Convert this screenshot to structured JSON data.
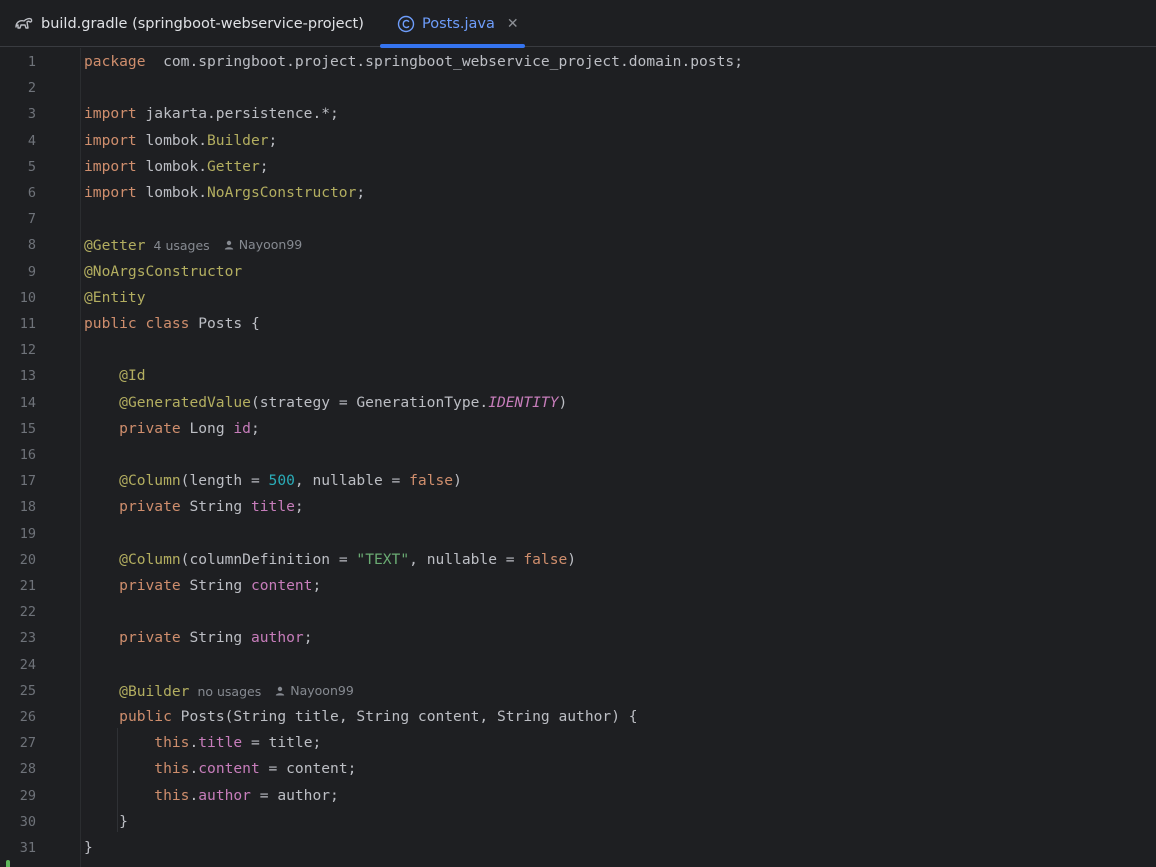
{
  "tabs": [
    {
      "label": "build.gradle (springboot-webservice-project)",
      "icon": "gradle-elephant-icon",
      "active": false
    },
    {
      "label": "Posts.java",
      "icon": "class-c-icon",
      "active": true,
      "close": "✕"
    }
  ],
  "colors": {
    "background": "#1e1f22",
    "keyword": "#cf8e6d",
    "annotation": "#b3ae60",
    "field": "#c77dbb",
    "number": "#2aacb8",
    "string": "#6aab73",
    "accent": "#3574f0"
  },
  "editor": {
    "lines": [
      {
        "n": "1",
        "parts": [
          [
            "kw",
            "package"
          ],
          [
            "",
            "  com.springboot.project.springboot_webservice_project.domain.posts;"
          ]
        ]
      },
      {
        "n": "2",
        "parts": []
      },
      {
        "n": "3",
        "parts": [
          [
            "kw",
            "import"
          ],
          [
            "",
            " jakarta.persistence.*;"
          ]
        ]
      },
      {
        "n": "4",
        "parts": [
          [
            "kw",
            "import"
          ],
          [
            "",
            " lombok."
          ],
          [
            "cls",
            "Builder"
          ],
          [
            "",
            ";"
          ]
        ]
      },
      {
        "n": "5",
        "parts": [
          [
            "kw",
            "import"
          ],
          [
            "",
            " lombok."
          ],
          [
            "cls",
            "Getter"
          ],
          [
            "",
            ";"
          ]
        ]
      },
      {
        "n": "6",
        "parts": [
          [
            "kw",
            "import"
          ],
          [
            "",
            " lombok."
          ],
          [
            "cls",
            "NoArgsConstructor"
          ],
          [
            "",
            ";"
          ]
        ]
      },
      {
        "n": "7",
        "parts": []
      },
      {
        "n": "8",
        "parts": [
          [
            "ann",
            "@Getter"
          ]
        ],
        "hint": "4 usages",
        "user": "Nayoon99"
      },
      {
        "n": "9",
        "parts": [
          [
            "ann",
            "@NoArgsConstructor"
          ]
        ]
      },
      {
        "n": "10",
        "parts": [
          [
            "ann",
            "@Entity"
          ]
        ]
      },
      {
        "n": "11",
        "parts": [
          [
            "kw",
            "public class"
          ],
          [
            "",
            " Posts {"
          ]
        ]
      },
      {
        "n": "12",
        "parts": []
      },
      {
        "n": "13",
        "parts": [
          [
            "",
            "    "
          ],
          [
            "ann",
            "@Id"
          ]
        ]
      },
      {
        "n": "14",
        "parts": [
          [
            "",
            "    "
          ],
          [
            "ann",
            "@GeneratedValue"
          ],
          [
            "",
            "(strategy = GenerationType."
          ],
          [
            "const",
            "IDENTITY"
          ],
          [
            "",
            ")"
          ]
        ]
      },
      {
        "n": "15",
        "parts": [
          [
            "",
            "    "
          ],
          [
            "kw",
            "private"
          ],
          [
            "",
            " Long "
          ],
          [
            "fld",
            "id"
          ],
          [
            "",
            ";"
          ]
        ]
      },
      {
        "n": "16",
        "parts": []
      },
      {
        "n": "17",
        "parts": [
          [
            "",
            "    "
          ],
          [
            "ann",
            "@Column"
          ],
          [
            "",
            "(length = "
          ],
          [
            "num",
            "500"
          ],
          [
            "",
            ", nullable = "
          ],
          [
            "kw",
            "false"
          ],
          [
            "",
            ")"
          ]
        ]
      },
      {
        "n": "18",
        "parts": [
          [
            "",
            "    "
          ],
          [
            "kw",
            "private"
          ],
          [
            "",
            " String "
          ],
          [
            "fld",
            "title"
          ],
          [
            "",
            ";"
          ]
        ]
      },
      {
        "n": "19",
        "parts": []
      },
      {
        "n": "20",
        "parts": [
          [
            "",
            "    "
          ],
          [
            "ann",
            "@Column"
          ],
          [
            "",
            "(columnDefinition = "
          ],
          [
            "str",
            "\"TEXT\""
          ],
          [
            "",
            ", nullable = "
          ],
          [
            "kw",
            "false"
          ],
          [
            "",
            ")"
          ]
        ]
      },
      {
        "n": "21",
        "parts": [
          [
            "",
            "    "
          ],
          [
            "kw",
            "private"
          ],
          [
            "",
            " String "
          ],
          [
            "fld",
            "content"
          ],
          [
            "",
            ";"
          ]
        ]
      },
      {
        "n": "22",
        "parts": []
      },
      {
        "n": "23",
        "parts": [
          [
            "",
            "    "
          ],
          [
            "kw",
            "private"
          ],
          [
            "",
            " String "
          ],
          [
            "fld",
            "author"
          ],
          [
            "",
            ";"
          ]
        ]
      },
      {
        "n": "24",
        "parts": []
      },
      {
        "n": "25",
        "parts": [
          [
            "",
            "    "
          ],
          [
            "ann",
            "@Builder"
          ]
        ],
        "hint": "no usages",
        "user": "Nayoon99"
      },
      {
        "n": "26",
        "parts": [
          [
            "",
            "    "
          ],
          [
            "kw",
            "public"
          ],
          [
            "",
            " "
          ],
          [
            "",
            "Posts"
          ],
          [
            "",
            "(String title, String content, String author) {"
          ]
        ]
      },
      {
        "n": "27",
        "parts": [
          [
            "",
            "        "
          ],
          [
            "kw",
            "this"
          ],
          [
            "",
            "."
          ],
          [
            "fld",
            "title"
          ],
          [
            "",
            " = title;"
          ]
        ]
      },
      {
        "n": "28",
        "parts": [
          [
            "",
            "        "
          ],
          [
            "kw",
            "this"
          ],
          [
            "",
            "."
          ],
          [
            "fld",
            "content"
          ],
          [
            "",
            " = content;"
          ]
        ]
      },
      {
        "n": "29",
        "parts": [
          [
            "",
            "        "
          ],
          [
            "kw",
            "this"
          ],
          [
            "",
            "."
          ],
          [
            "fld",
            "author"
          ],
          [
            "",
            " = author;"
          ]
        ]
      },
      {
        "n": "30",
        "parts": [
          [
            "",
            "    }"
          ]
        ]
      },
      {
        "n": "31",
        "parts": [
          [
            "",
            "}"
          ]
        ]
      }
    ]
  }
}
